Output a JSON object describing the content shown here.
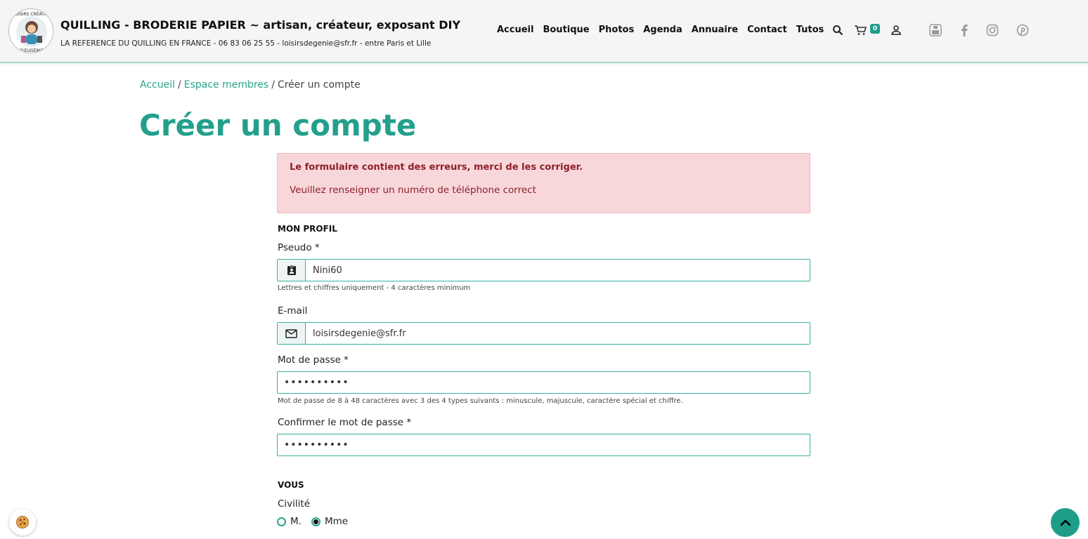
{
  "header": {
    "logo_text": "LOISIRS CRÉATIFS D'EUGÉNIE",
    "title": "QUILLING - BRODERIE PAPIER ~ artisan, créateur, exposant DIY",
    "subtitle": "LA REFERENCE DU QUILLING EN FRANCE - 06 83 06 25 55 - loisirsdegenie@sfr.fr - entre Paris et Lille",
    "nav": [
      "Accueil",
      "Boutique",
      "Photos",
      "Agenda",
      "Annuaire",
      "Contact",
      "Tutos"
    ],
    "cart_count": "0",
    "icons": [
      "search-icon",
      "cart-icon",
      "user-icon",
      "youtube-icon",
      "facebook-icon",
      "instagram-icon",
      "pinterest-icon"
    ]
  },
  "breadcrumb": [
    "Accueil",
    "Espace membres",
    "Créer un compte"
  ],
  "page_title": "Créer un compte",
  "alert": {
    "title": "Le formulaire contient des erreurs, merci de les corriger.",
    "message": "Veuillez renseigner un numéro de téléphone correct"
  },
  "profile": {
    "section_title": "MON PROFIL",
    "pseudo_label": "Pseudo *",
    "pseudo_value": "Nini60",
    "pseudo_help": "Lettres et chiffres uniquement - 4 caractères minimum",
    "email_label": "E-mail",
    "email_value": "loisirsdegenie@sfr.fr",
    "password_label": "Mot de passe *",
    "password_value": "••••••••••",
    "password_help": "Mot de passe de 8 à 48 caractères avec 3 des 4 types suivants : minuscule, majuscule, caractère spécial et chiffre.",
    "confirm_label": "Confirmer le mot de passe *",
    "confirm_value": "••••••••••"
  },
  "vous": {
    "section_title": "VOUS",
    "civility_label": "Civilité",
    "options": [
      "M.",
      "Mme"
    ],
    "selected": "Mme"
  },
  "colors": {
    "accent": "#23a08c",
    "alert_bg": "#f8d7da",
    "alert_text": "#8e1f2b"
  }
}
